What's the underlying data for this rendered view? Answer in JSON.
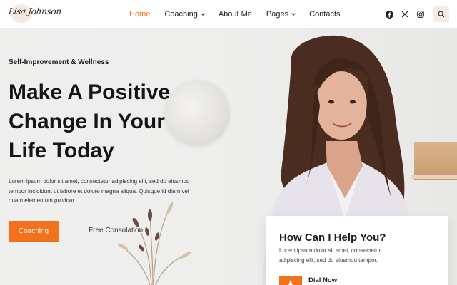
{
  "brand": {
    "logo_text": "Lisa Johnson"
  },
  "nav": {
    "items": [
      {
        "label": "Home",
        "active": true,
        "has_dropdown": false
      },
      {
        "label": "Coaching",
        "active": false,
        "has_dropdown": true
      },
      {
        "label": "About Me",
        "active": false,
        "has_dropdown": false
      },
      {
        "label": "Pages",
        "active": false,
        "has_dropdown": true
      },
      {
        "label": "Contacts",
        "active": false,
        "has_dropdown": false
      }
    ],
    "social_icons": [
      "facebook-icon",
      "x-twitter-icon",
      "instagram-icon"
    ],
    "search_icon": "search-icon"
  },
  "hero": {
    "eyebrow": "Self-Improvement & Wellness",
    "headline_lines": [
      "Make A Positive",
      "Change In Your",
      "Life Today"
    ],
    "paragraph_lines": [
      "Lorem ipsum dolor sit amet, consectetur adipiscing elit, sed do eiusmod",
      "tempor incididunt ut labore et dolore magna aliqua. Quisque id diam vel",
      "quam elementum pulvinar."
    ],
    "primary_button": "Coaching",
    "secondary_link": "Free Consulation"
  },
  "help_card": {
    "title": "How Can I Help You?",
    "text_lines": [
      "Lorem ipsum dolor sit amet, consectetur",
      "adipiscing elit, sed do eiusmod tempor."
    ],
    "dial_label": "Dial Now"
  },
  "colors": {
    "accent": "#f2711c",
    "text_dark": "#1d1d1d",
    "hero_bg": "#eeeeed",
    "header_bg": "#ffffff"
  }
}
